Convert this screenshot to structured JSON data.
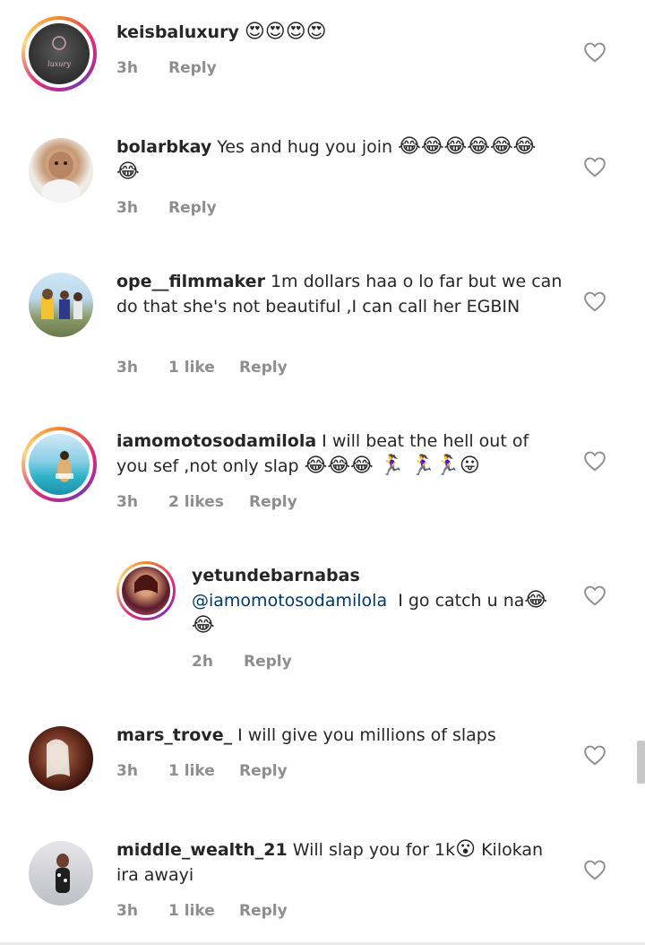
{
  "comments": [
    {
      "username": "keisbaluxury",
      "text": "",
      "emoji": "😍😍😍😍",
      "time": "3h",
      "likes": "",
      "reply": "Reply"
    },
    {
      "username": "bolarbkay",
      "text": "Yes and hug you join",
      "emoji": "😂😂😂😂😂😂 😂",
      "time": "3h",
      "likes": "",
      "reply": "Reply"
    },
    {
      "username": "ope__filmmaker",
      "text": "1m dollars haa o lo far but we can do that she's not beautiful ,I can call her EGBIN",
      "emoji": "",
      "time": "3h",
      "likes": "1 like",
      "reply": "Reply"
    },
    {
      "username": "iamomotosodamilola",
      "text": "I will beat the hell out of you sef ,not only slap",
      "emoji": "😂😂😂 🏃‍♀️ 🏃‍♀️🏃‍♀️😛",
      "time": "3h",
      "likes": "2 likes",
      "reply": "Reply"
    },
    {
      "username": "yetundebarnabas",
      "mention": "@iamomotosodamilola",
      "text": "I go catch u na",
      "emoji": "😂 😂",
      "time": "2h",
      "likes": "",
      "reply": "Reply"
    },
    {
      "username": "mars_trove_",
      "text": "I will give you millions of slaps",
      "emoji": "",
      "time": "3h",
      "likes": "1 like",
      "reply": "Reply"
    },
    {
      "username": "middle_wealth_21",
      "text": "Will slap you for 1k",
      "emoji": "😮",
      "text2": "Kilokan ira awayi",
      "time": "3h",
      "likes": "1 like",
      "reply": "Reply"
    }
  ],
  "icons": {
    "like": "heart-outline-icon"
  },
  "colors": {
    "text": "#262626",
    "meta": "#8e8e8e",
    "mention": "#00376b"
  }
}
